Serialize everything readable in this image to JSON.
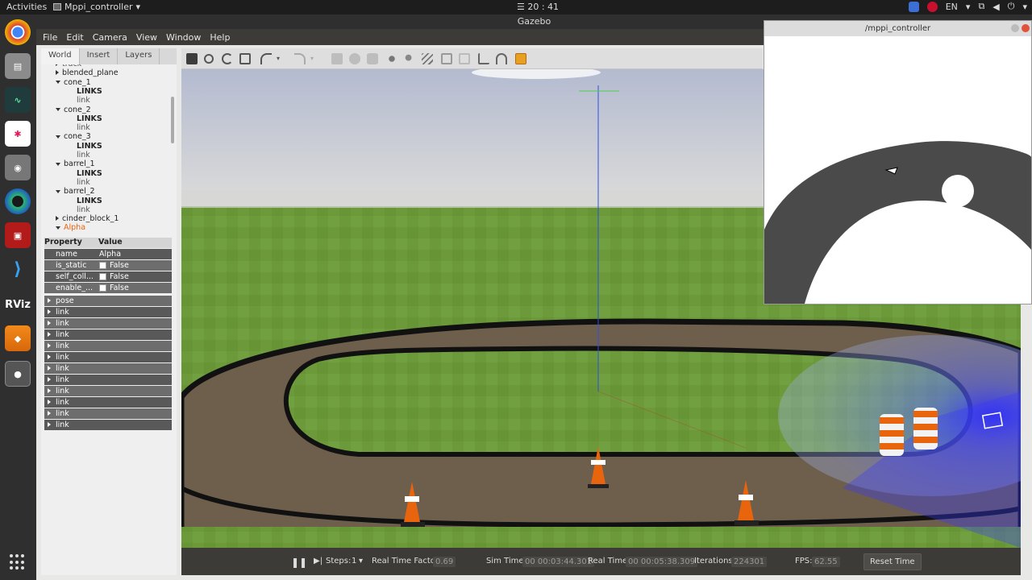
{
  "topbar": {
    "activities": "Activities",
    "app_name": "Mppi_controller",
    "clock": "☰ 20 : 41",
    "lang": "EN"
  },
  "gazebo": {
    "title": "Gazebo",
    "menu": [
      "File",
      "Edit",
      "Camera",
      "View",
      "Window",
      "Help"
    ],
    "tabs": [
      "World",
      "Insert",
      "Layers"
    ],
    "tree": [
      {
        "label": "track",
        "indent": 1,
        "icon": "right",
        "style": "muted"
      },
      {
        "label": "blended_plane",
        "indent": 1,
        "icon": "right"
      },
      {
        "label": "cone_1",
        "indent": 1,
        "icon": "down"
      },
      {
        "label": "LINKS",
        "indent": 3,
        "style": "bold"
      },
      {
        "label": "link",
        "indent": 3,
        "style": "muted"
      },
      {
        "label": "cone_2",
        "indent": 1,
        "icon": "down"
      },
      {
        "label": "LINKS",
        "indent": 3,
        "style": "bold"
      },
      {
        "label": "link",
        "indent": 3,
        "style": "muted"
      },
      {
        "label": "cone_3",
        "indent": 1,
        "icon": "down"
      },
      {
        "label": "LINKS",
        "indent": 3,
        "style": "bold"
      },
      {
        "label": "link",
        "indent": 3,
        "style": "muted"
      },
      {
        "label": "barrel_1",
        "indent": 1,
        "icon": "down"
      },
      {
        "label": "LINKS",
        "indent": 3,
        "style": "bold"
      },
      {
        "label": "link",
        "indent": 3,
        "style": "muted"
      },
      {
        "label": "barrel_2",
        "indent": 1,
        "icon": "down"
      },
      {
        "label": "LINKS",
        "indent": 3,
        "style": "bold"
      },
      {
        "label": "link",
        "indent": 3,
        "style": "muted"
      },
      {
        "label": "cinder_block_1",
        "indent": 1,
        "icon": "right"
      },
      {
        "label": "Alpha",
        "indent": 1,
        "icon": "down",
        "style": "selected"
      }
    ],
    "properties": {
      "header_property": "Property",
      "header_value": "Value",
      "rows": [
        {
          "key": "name",
          "value": "Alpha",
          "checkbox": false
        },
        {
          "key": "is_static",
          "value": "False",
          "checkbox": true
        },
        {
          "key": "self_coll...",
          "value": "False",
          "checkbox": true
        },
        {
          "key": "enable_...",
          "value": "False",
          "checkbox": true
        }
      ],
      "groups": [
        "pose",
        "link",
        "link",
        "link",
        "link",
        "link",
        "link",
        "link",
        "link",
        "link",
        "link",
        "link"
      ]
    },
    "bottom": {
      "steps_label": "Steps:",
      "steps_value": "1",
      "rtf_label": "Real Time Factor:",
      "rtf_value": "0.69",
      "sim_label": "Sim Time:",
      "sim_value": "00 00:03:44.301",
      "real_label": "Real Time:",
      "real_value": "00 00:05:38.309",
      "iter_label": "Iterations:",
      "iter_value": "224301",
      "fps_label": "FPS:",
      "fps_value": "62.55",
      "reset": "Reset Time"
    }
  },
  "mppi_window": {
    "title": "/mppi_controller"
  },
  "colors": {
    "grass": "#6b9a3a",
    "track": "#6b5a48",
    "sky_top": "#b9bfd2",
    "sky_bottom": "#d9d9d7",
    "accent_orange": "#e8650e",
    "costmap_dark": "#4a4a4a"
  }
}
